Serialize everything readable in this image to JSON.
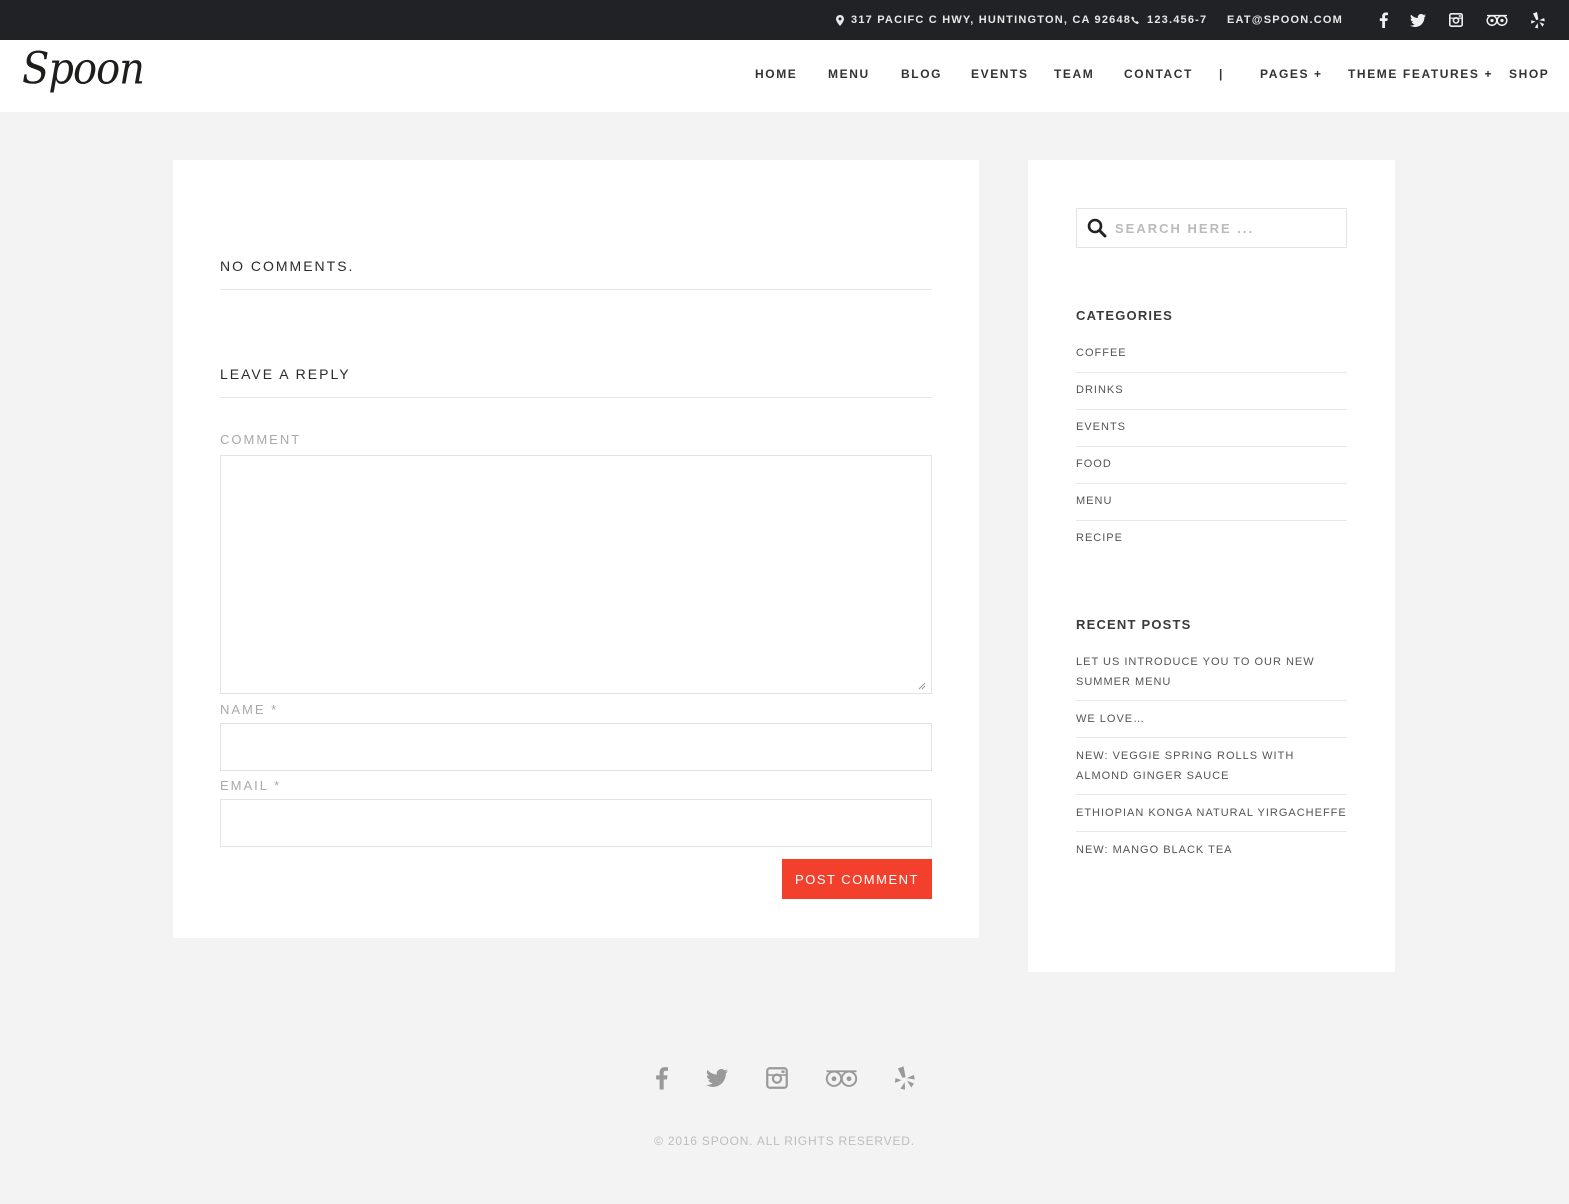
{
  "topbar": {
    "address": "317 PACIFC C HWY, HUNTINGTON, CA 92648",
    "phone": "123.456-7",
    "email": "EAT@SPOON.COM",
    "social_icons": [
      "facebook-icon",
      "twitter-icon",
      "instagram-icon",
      "tripadvisor-icon",
      "yelp-icon"
    ]
  },
  "header": {
    "logo": "Spoon",
    "nav": [
      "HOME",
      "MENU",
      "BLOG",
      "EVENTS",
      "TEAM",
      "CONTACT",
      "|",
      "PAGES +",
      "THEME FEATURES +",
      "SHOP"
    ]
  },
  "comments": {
    "no_comments": "NO COMMENTS.",
    "reply_title": "LEAVE A REPLY",
    "comment_label": "COMMENT",
    "comment_value": "",
    "name_label": "NAME *",
    "name_value": "",
    "email_label": "EMAIL *",
    "email_value": "",
    "submit_label": "POST COMMENT"
  },
  "sidebar": {
    "search_placeholder": "SEARCH HERE ...",
    "categories_title": "CATEGORIES",
    "categories": [
      "COFFEE",
      "DRINKS",
      "EVENTS",
      "FOOD",
      "MENU",
      "RECIPE"
    ],
    "recent_title": "RECENT POSTS",
    "recent_posts": [
      "LET US INTRODUCE YOU TO OUR NEW SUMMER MENU",
      "WE LOVE…",
      "NEW: VEGGIE SPRING ROLLS WITH ALMOND GINGER SAUCE",
      "ETHIOPIAN KONGA NATURAL YIRGACHEFFE",
      "NEW: MANGO BLACK TEA"
    ]
  },
  "footer": {
    "social_icons": [
      "facebook-icon",
      "twitter-icon",
      "instagram-icon",
      "tripadvisor-icon",
      "yelp-icon"
    ],
    "copyright": "© 2016 SPOON. ALL RIGHTS RESERVED."
  },
  "colors": {
    "accent": "#f2402d",
    "topbar_bg": "#202226",
    "page_bg": "#f3f3f3"
  }
}
